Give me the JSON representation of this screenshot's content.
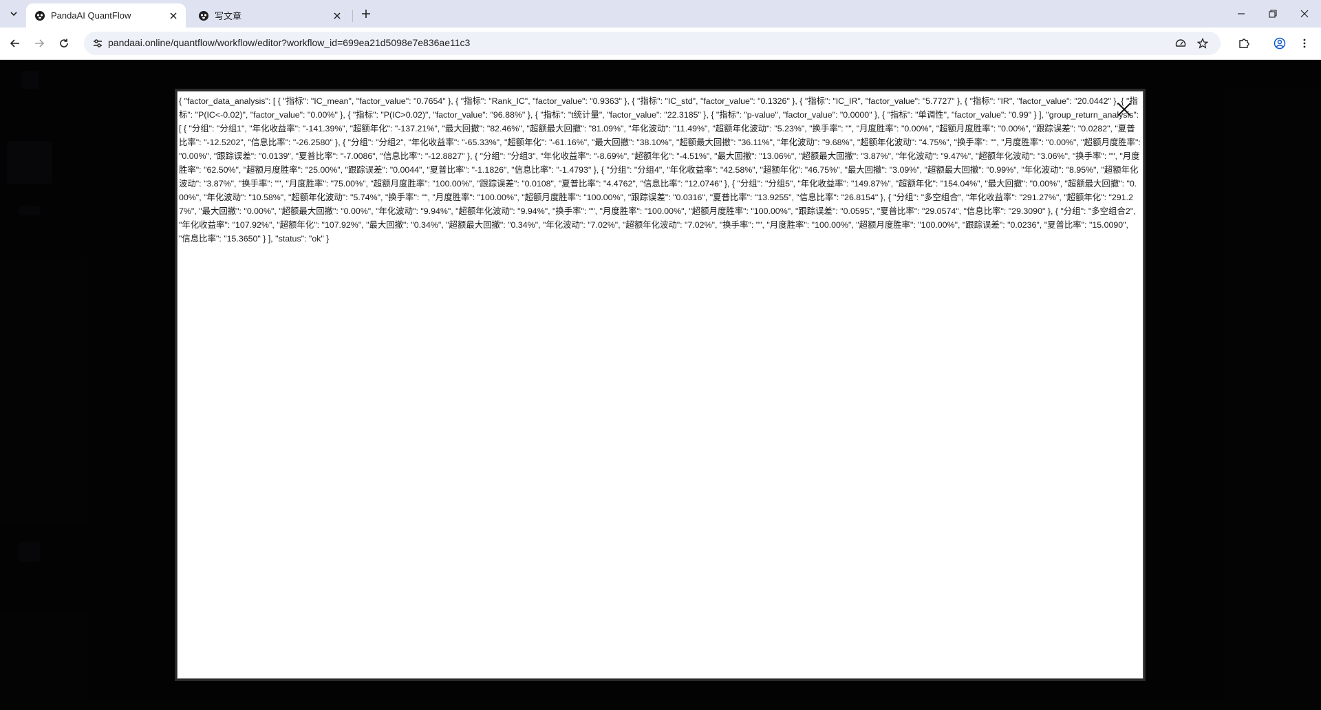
{
  "browser": {
    "tabs": [
      {
        "title": "PandaAI QuantFlow",
        "active": true
      },
      {
        "title": "写文章",
        "active": false
      }
    ],
    "url": "pandaai.online/quantflow/workflow/editor?workflow_id=699ea21d5098e7e836ae11c3"
  },
  "icons": {
    "tab_list": "chevron-down-icon",
    "favicon": "panda-icon",
    "tab_close": "close-icon",
    "new_tab": "plus-icon",
    "back": "back-arrow-icon",
    "forward": "forward-arrow-icon",
    "reload": "reload-icon",
    "site_info": "tune-icon",
    "performance": "speedometer-icon",
    "bookmark": "star-icon",
    "extensions": "puzzle-icon",
    "profile": "account-icon",
    "menu": "kebab-menu-icon"
  },
  "modal": {
    "content": "{ \"factor_data_analysis\": [ { \"指标\": \"IC_mean\", \"factor_value\": \"0.7654\" }, { \"指标\": \"Rank_IC\", \"factor_value\": \"0.9363\" }, { \"指标\": \"IC_std\", \"factor_value\": \"0.1326\" }, { \"指标\": \"IC_IR\", \"factor_value\": \"5.7727\" }, { \"指标\": \"IR\", \"factor_value\": \"20.0442\" }, { \"指标\": \"P(IC<-0.02)\", \"factor_value\": \"0.00%\" }, { \"指标\": \"P(IC>0.02)\", \"factor_value\": \"96.88%\" }, { \"指标\": \"t统计量\", \"factor_value\": \"22.3185\" }, { \"指标\": \"p-value\", \"factor_value\": \"0.0000\" }, { \"指标\": \"单调性\", \"factor_value\": \"0.99\" } ], \"group_return_analysis\": [ { \"分组\": \"分组1\", \"年化收益率\": \"-141.39%\", \"超额年化\": \"-137.21%\", \"最大回撤\": \"82.46%\", \"超额最大回撤\": \"81.09%\", \"年化波动\": \"11.49%\", \"超额年化波动\": \"5.23%\", \"换手率\": \"\", \"月度胜率\": \"0.00%\", \"超额月度胜率\": \"0.00%\", \"跟踪误差\": \"0.0282\", \"夏普比率\": \"-12.5202\", \"信息比率\": \"-26.2580\" }, { \"分组\": \"分组2\", \"年化收益率\": \"-65.33%\", \"超额年化\": \"-61.16%\", \"最大回撤\": \"38.10%\", \"超额最大回撤\": \"36.11%\", \"年化波动\": \"9.68%\", \"超额年化波动\": \"4.75%\", \"换手率\": \"\", \"月度胜率\": \"0.00%\", \"超额月度胜率\": \"0.00%\", \"跟踪误差\": \"0.0139\", \"夏普比率\": \"-7.0086\", \"信息比率\": \"-12.8827\" }, { \"分组\": \"分组3\", \"年化收益率\": \"-8.69%\", \"超额年化\": \"-4.51%\", \"最大回撤\": \"13.06%\", \"超额最大回撤\": \"3.87%\", \"年化波动\": \"9.47%\", \"超额年化波动\": \"3.06%\", \"换手率\": \"\", \"月度胜率\": \"62.50%\", \"超额月度胜率\": \"25.00%\", \"跟踪误差\": \"0.0044\", \"夏普比率\": \"-1.1826\", \"信息比率\": \"-1.4793\" }, { \"分组\": \"分组4\", \"年化收益率\": \"42.58%\", \"超额年化\": \"46.75%\", \"最大回撤\": \"3.09%\", \"超额最大回撤\": \"0.99%\", \"年化波动\": \"8.95%\", \"超额年化波动\": \"3.87%\", \"换手率\": \"\", \"月度胜率\": \"75.00%\", \"超额月度胜率\": \"100.00%\", \"跟踪误差\": \"0.0108\", \"夏普比率\": \"4.4762\", \"信息比率\": \"12.0746\" }, { \"分组\": \"分组5\", \"年化收益率\": \"149.87%\", \"超额年化\": \"154.04%\", \"最大回撤\": \"0.00%\", \"超额最大回撤\": \"0.00%\", \"年化波动\": \"10.58%\", \"超额年化波动\": \"5.74%\", \"换手率\": \"\", \"月度胜率\": \"100.00%\", \"超额月度胜率\": \"100.00%\", \"跟踪误差\": \"0.0316\", \"夏普比率\": \"13.9255\", \"信息比率\": \"26.8154\" }, { \"分组\": \"多空组合\", \"年化收益率\": \"291.27%\", \"超额年化\": \"291.27%\", \"最大回撤\": \"0.00%\", \"超额最大回撤\": \"0.00%\", \"年化波动\": \"9.94%\", \"超额年化波动\": \"9.94%\", \"换手率\": \"\", \"月度胜率\": \"100.00%\", \"超额月度胜率\": \"100.00%\", \"跟踪误差\": \"0.0595\", \"夏普比率\": \"29.0574\", \"信息比率\": \"29.3090\" }, { \"分组\": \"多空组合2\", \"年化收益率\": \"107.92%\", \"超额年化\": \"107.92%\", \"最大回撤\": \"0.34%\", \"超额最大回撤\": \"0.34%\", \"年化波动\": \"7.02%\", \"超额年化波动\": \"7.02%\", \"换手率\": \"\", \"月度胜率\": \"100.00%\", \"超额月度胜率\": \"100.00%\", \"跟踪误差\": \"0.0236\", \"夏普比率\": \"15.0090\", \"信息比率\": \"15.3650\" } ], \"status\": \"ok\" }"
  }
}
